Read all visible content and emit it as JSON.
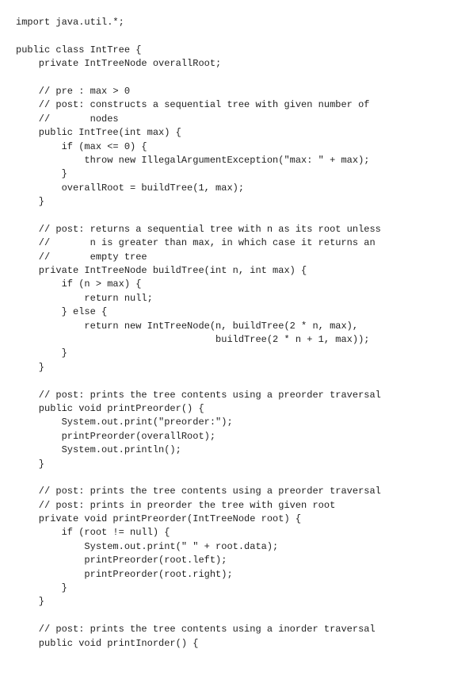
{
  "code": {
    "lines": [
      "import java.util.*;",
      "",
      "public class IntTree {",
      "    private IntTreeNode overallRoot;",
      "",
      "    // pre : max > 0",
      "    // post: constructs a sequential tree with given number of",
      "    //       nodes",
      "    public IntTree(int max) {",
      "        if (max <= 0) {",
      "            throw new IllegalArgumentException(\"max: \" + max);",
      "        }",
      "        overallRoot = buildTree(1, max);",
      "    }",
      "",
      "    // post: returns a sequential tree with n as its root unless",
      "    //       n is greater than max, in which case it returns an",
      "    //       empty tree",
      "    private IntTreeNode buildTree(int n, int max) {",
      "        if (n > max) {",
      "            return null;",
      "        } else {",
      "            return new IntTreeNode(n, buildTree(2 * n, max),",
      "                                   buildTree(2 * n + 1, max));",
      "        }",
      "    }",
      "",
      "    // post: prints the tree contents using a preorder traversal",
      "    public void printPreorder() {",
      "        System.out.print(\"preorder:\");",
      "        printPreorder(overallRoot);",
      "        System.out.println();",
      "    }",
      "",
      "    // post: prints the tree contents using a preorder traversal",
      "    // post: prints in preorder the tree with given root",
      "    private void printPreorder(IntTreeNode root) {",
      "        if (root != null) {",
      "            System.out.print(\" \" + root.data);",
      "            printPreorder(root.left);",
      "            printPreorder(root.right);",
      "        }",
      "    }",
      "",
      "    // post: prints the tree contents using a inorder traversal",
      "    public void printInorder() {"
    ]
  }
}
